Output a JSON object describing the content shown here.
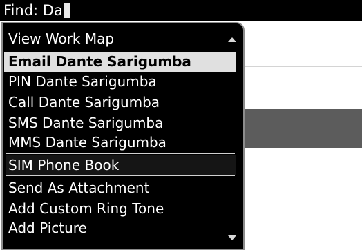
{
  "find": {
    "label": "Find:",
    "value": "Da"
  },
  "menu": {
    "items": [
      {
        "label": "View Work Map"
      },
      {
        "label": "Email Dante Sarigumba",
        "selected": true
      },
      {
        "label": "PIN Dante Sarigumba"
      },
      {
        "label": "Call Dante Sarigumba"
      },
      {
        "label": "SMS Dante Sarigumba"
      },
      {
        "label": "MMS Dante Sarigumba"
      },
      {
        "label": "SIM Phone Book"
      },
      {
        "label": "Send As Attachment"
      },
      {
        "label": "Add Custom Ring Tone"
      },
      {
        "label": "Add Picture"
      }
    ]
  },
  "icons": {
    "scroll_up": "triangle-up-icon",
    "scroll_down": "triangle-down-icon"
  },
  "colors": {
    "menu_background": "#000000",
    "selected_background": "#e0e0e0",
    "find_bar": "#000000"
  }
}
